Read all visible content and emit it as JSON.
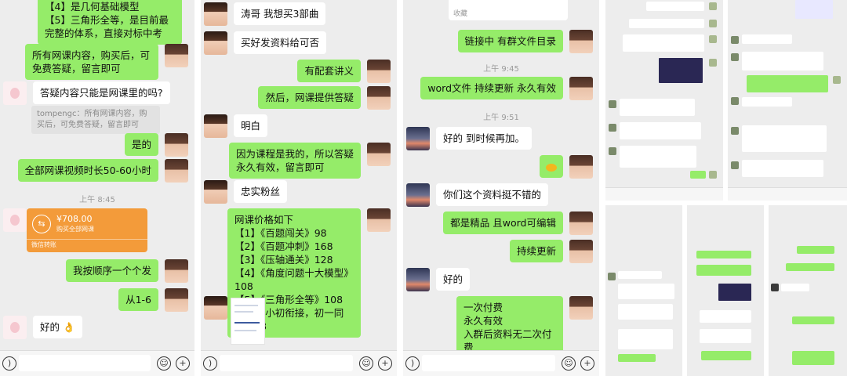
{
  "panel1": {
    "top_bubble_lines": [
      "【4】是几何基础模型",
      "【5】三角形全等，是目前最完整的体系，直接对标中考"
    ],
    "msg_all_content": "所有网课内容，购买后，可免费答疑，留言即可",
    "msg_question": "答疑内容只能是网课里的吗?",
    "quote": "tompengc：所有网课内容，购买后，可免费答疑，留言即可",
    "msg_shide": "是的",
    "msg_hours": "全部网课视频时长50-60小时",
    "time": "上午 8:45",
    "payment": {
      "amount": "¥708.00",
      "sub": "购买全部网课",
      "label": "微信转账",
      "icon": "⇆"
    },
    "msg_order": "我按顺序一个个发",
    "msg_range": "从1-6",
    "msg_ok": "好的",
    "ok_emoji": "👌"
  },
  "panel2": {
    "msg_taoge": "涛哥 我想买3部曲",
    "msg_material": "买好发资料给可否",
    "msg_notes": "有配套讲义",
    "msg_answer": "然后，网课提供答疑",
    "msg_understand": "明白",
    "msg_because": "因为课程是我的，所以答疑永久有效，留言即可",
    "msg_fan": "忠实粉丝",
    "price_title": "网课价格如下",
    "price_lines": [
      "【1】《百题闯关》98",
      "【2】《百题冲刺》168",
      "【3】《压轴通关》128",
      "【4】《角度问题十大模型》108",
      "【5】《三角形全等》108",
      "【6】《小初衔接，初一同步》98"
    ]
  },
  "panel3": {
    "fav_label": "收藏",
    "msg_link": "链接中 有群文件目录",
    "time1": "上午 9:45",
    "msg_word": "word文件 持续更新 永久有效",
    "time2": "上午 9:51",
    "msg_good": "好的   到时候再加。",
    "msg_nice": "你们这个资料挺不错的",
    "msg_quality": "都是精品 且word可编辑",
    "msg_update": "持续更新",
    "msg_ok": "好的",
    "msg_final_lines": [
      "一次付费",
      "永久有效",
      "入群后资料无二次付费"
    ]
  },
  "colors": {
    "green_bubble": "#95ec69",
    "chat_bg": "#ededed",
    "payment": "#f39b3a"
  },
  "icons": [
    "voice-icon",
    "emoji-icon",
    "plus-icon"
  ]
}
